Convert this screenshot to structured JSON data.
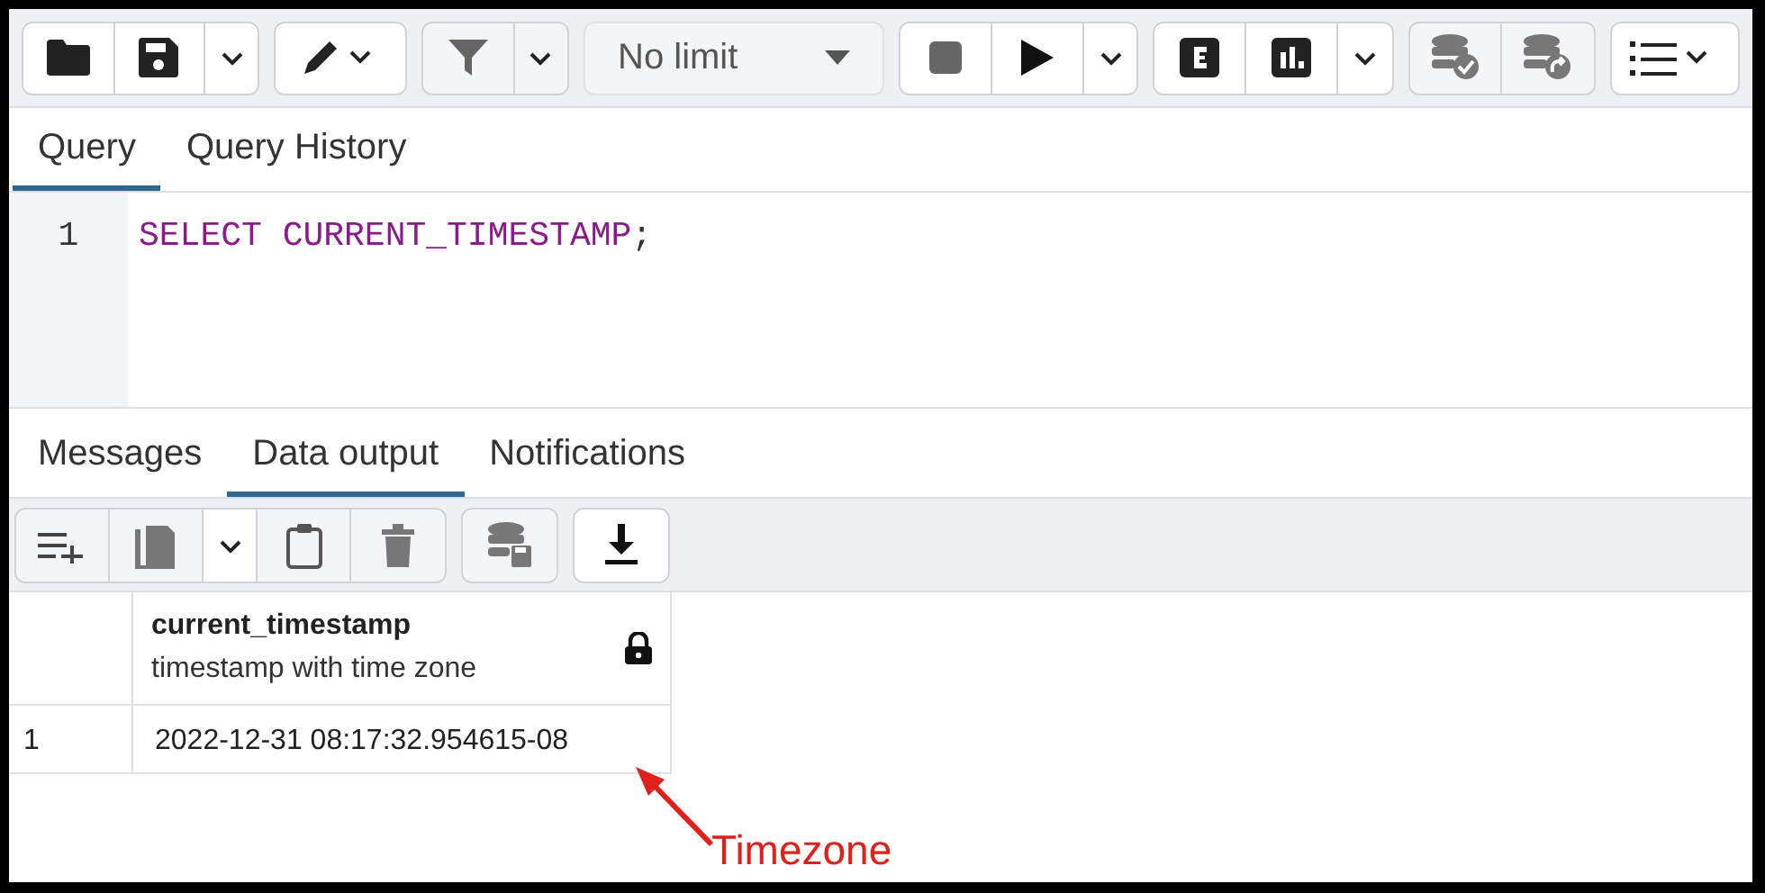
{
  "toolbar": {
    "limit": {
      "value": "No limit"
    }
  },
  "query_tabs": [
    {
      "label": "Query",
      "selected": true
    },
    {
      "label": "Query History",
      "selected": false
    }
  ],
  "editor": {
    "lines": [
      {
        "number": "1",
        "tokens": [
          {
            "text": "SELECT CURRENT_TIMESTAMP",
            "kind": "keyword"
          },
          {
            "text": ";",
            "kind": "punct"
          }
        ]
      }
    ]
  },
  "result_tabs": [
    {
      "label": "Messages",
      "selected": false
    },
    {
      "label": "Data output",
      "selected": true
    },
    {
      "label": "Notifications",
      "selected": false
    }
  ],
  "grid": {
    "columns": [
      {
        "name": "current_timestamp",
        "type": "timestamp with time zone",
        "locked": true
      }
    ],
    "rows": [
      {
        "number": "1",
        "cells": [
          "2022-12-31 08:17:32.954615-08"
        ]
      }
    ]
  },
  "annotation": {
    "label": "Timezone"
  }
}
